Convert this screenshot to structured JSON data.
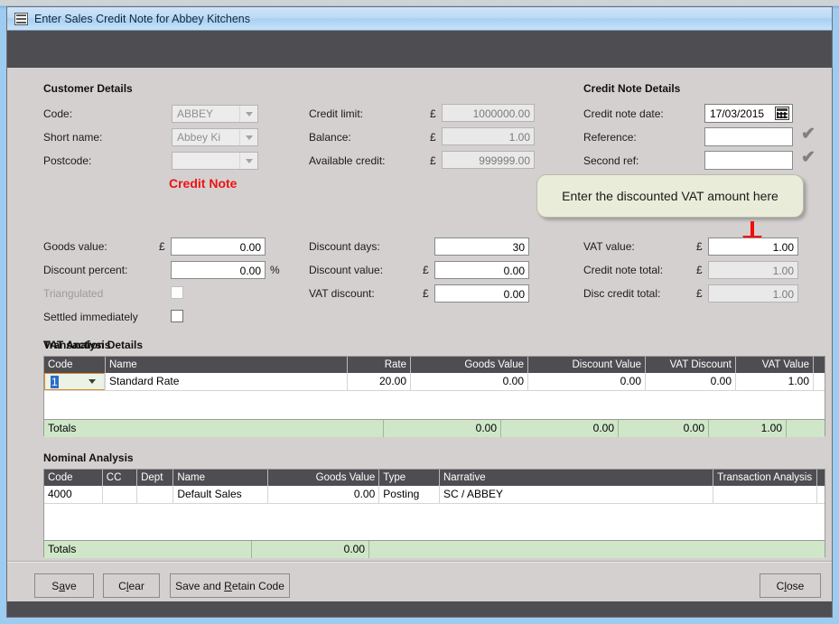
{
  "window": {
    "title": "Enter Sales Credit Note for Abbey Kitchens",
    "icon": "grid-window-icon"
  },
  "customer_details": {
    "heading": "Customer Details",
    "fields": [
      {
        "label": "Code:",
        "value": "ABBEY"
      },
      {
        "label": "Short name:",
        "value": "Abbey Ki"
      },
      {
        "label": "Postcode:",
        "value": ""
      }
    ],
    "doc_type": "Credit Note"
  },
  "credit_info": {
    "currency": "£",
    "fields": [
      {
        "label": "Credit limit:",
        "value": "1000000.00"
      },
      {
        "label": "Balance:",
        "value": "1.00"
      },
      {
        "label": "Available credit:",
        "value": "999999.00"
      }
    ]
  },
  "credit_note_details": {
    "heading": "Credit Note Details",
    "date_label": "Credit note date:",
    "date_value": "17/03/2015",
    "reference_label": "Reference:",
    "reference_value": "",
    "second_ref_label": "Second ref:",
    "second_ref_value": "",
    "tick_icon": "check-icon"
  },
  "callout": {
    "text": "Enter the discounted VAT amount here",
    "arrow_color": "#f60a0a"
  },
  "transaction_details": {
    "heading": "Transaction Details",
    "currency": "£",
    "percent": "%",
    "left": [
      {
        "label": "Goods value:",
        "value": "0.00"
      },
      {
        "label": "Discount percent:",
        "value": "0.00"
      }
    ],
    "checkboxes": [
      {
        "label": "Triangulated",
        "checked": false,
        "disabled": true
      },
      {
        "label": "Settled immediately",
        "checked": false,
        "disabled": false
      }
    ],
    "middle": [
      {
        "label": "Discount days:",
        "value": "30"
      },
      {
        "label": "Discount value:",
        "value": "0.00"
      },
      {
        "label": "VAT discount:",
        "value": "0.00"
      }
    ],
    "right": [
      {
        "label": "VAT value:",
        "value": "1.00"
      },
      {
        "label": "Credit note total:",
        "value": "1.00"
      },
      {
        "label": "Disc credit total:",
        "value": "1.00"
      }
    ]
  },
  "vat_analysis": {
    "heading": "VAT Analysis",
    "columns": [
      "Code",
      "Name",
      "Rate",
      "Goods Value",
      "Discount Value",
      "VAT Discount",
      "VAT Value"
    ],
    "rows": [
      {
        "code": "1",
        "name": "Standard Rate",
        "rate": "20.00",
        "goods_value": "0.00",
        "discount_value": "0.00",
        "vat_discount": "0.00",
        "vat_value": "1.00"
      }
    ],
    "totals": {
      "label": "Totals",
      "goods_value": "0.00",
      "discount_value": "0.00",
      "vat_discount": "0.00",
      "vat_value": "1.00"
    }
  },
  "nominal_analysis": {
    "heading": "Nominal Analysis",
    "columns": [
      "Code",
      "CC",
      "Dept",
      "Name",
      "Goods Value",
      "Type",
      "Narrative",
      "Transaction Analysis"
    ],
    "rows": [
      {
        "code": "4000",
        "cc": "",
        "dept": "",
        "name": "Default Sales",
        "goods_value": "0.00",
        "type": "Posting",
        "narrative": "SC / ABBEY",
        "transaction_analysis": ""
      }
    ],
    "totals": {
      "label": "Totals",
      "goods_value": "0.00"
    }
  },
  "buttons": {
    "save": {
      "pre": "S",
      "mnemonic": "a",
      "post": "ve"
    },
    "clear": {
      "pre": "C",
      "mnemonic": "l",
      "post": "ear"
    },
    "save_retain": {
      "pre": "Save and ",
      "mnemonic": "R",
      "post": "etain Code"
    },
    "close": {
      "pre": "C",
      "mnemonic": "l",
      "post": "ose"
    }
  }
}
